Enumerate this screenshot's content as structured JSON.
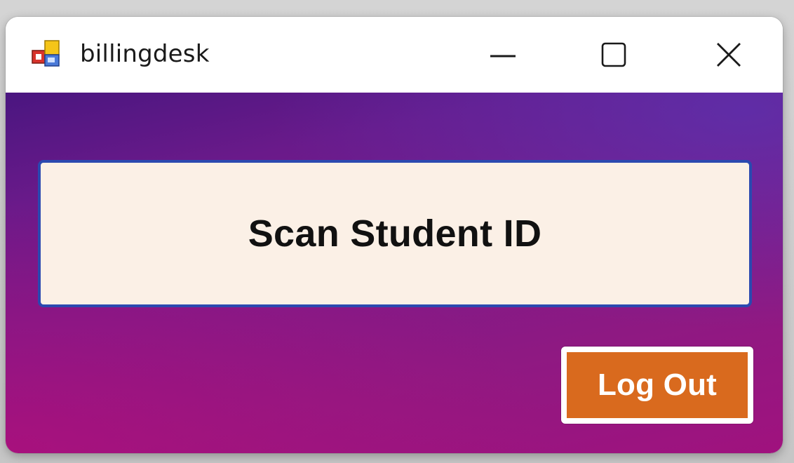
{
  "window": {
    "title": "billingdesk",
    "app_icon": "application-icon",
    "controls": {
      "minimize_icon": "minimize-icon",
      "maximize_icon": "maximize-icon",
      "close_icon": "close-icon"
    }
  },
  "main": {
    "scan_field_label": "Scan Student ID",
    "logout_label": "Log Out"
  },
  "colors": {
    "background_gradient_start": "#4a1680",
    "background_gradient_end": "#a0127e",
    "scan_field_background": "#fbf0e6",
    "scan_field_border": "#2b49b0",
    "logout_background": "#d96a1e",
    "logout_text": "#ffffff"
  }
}
